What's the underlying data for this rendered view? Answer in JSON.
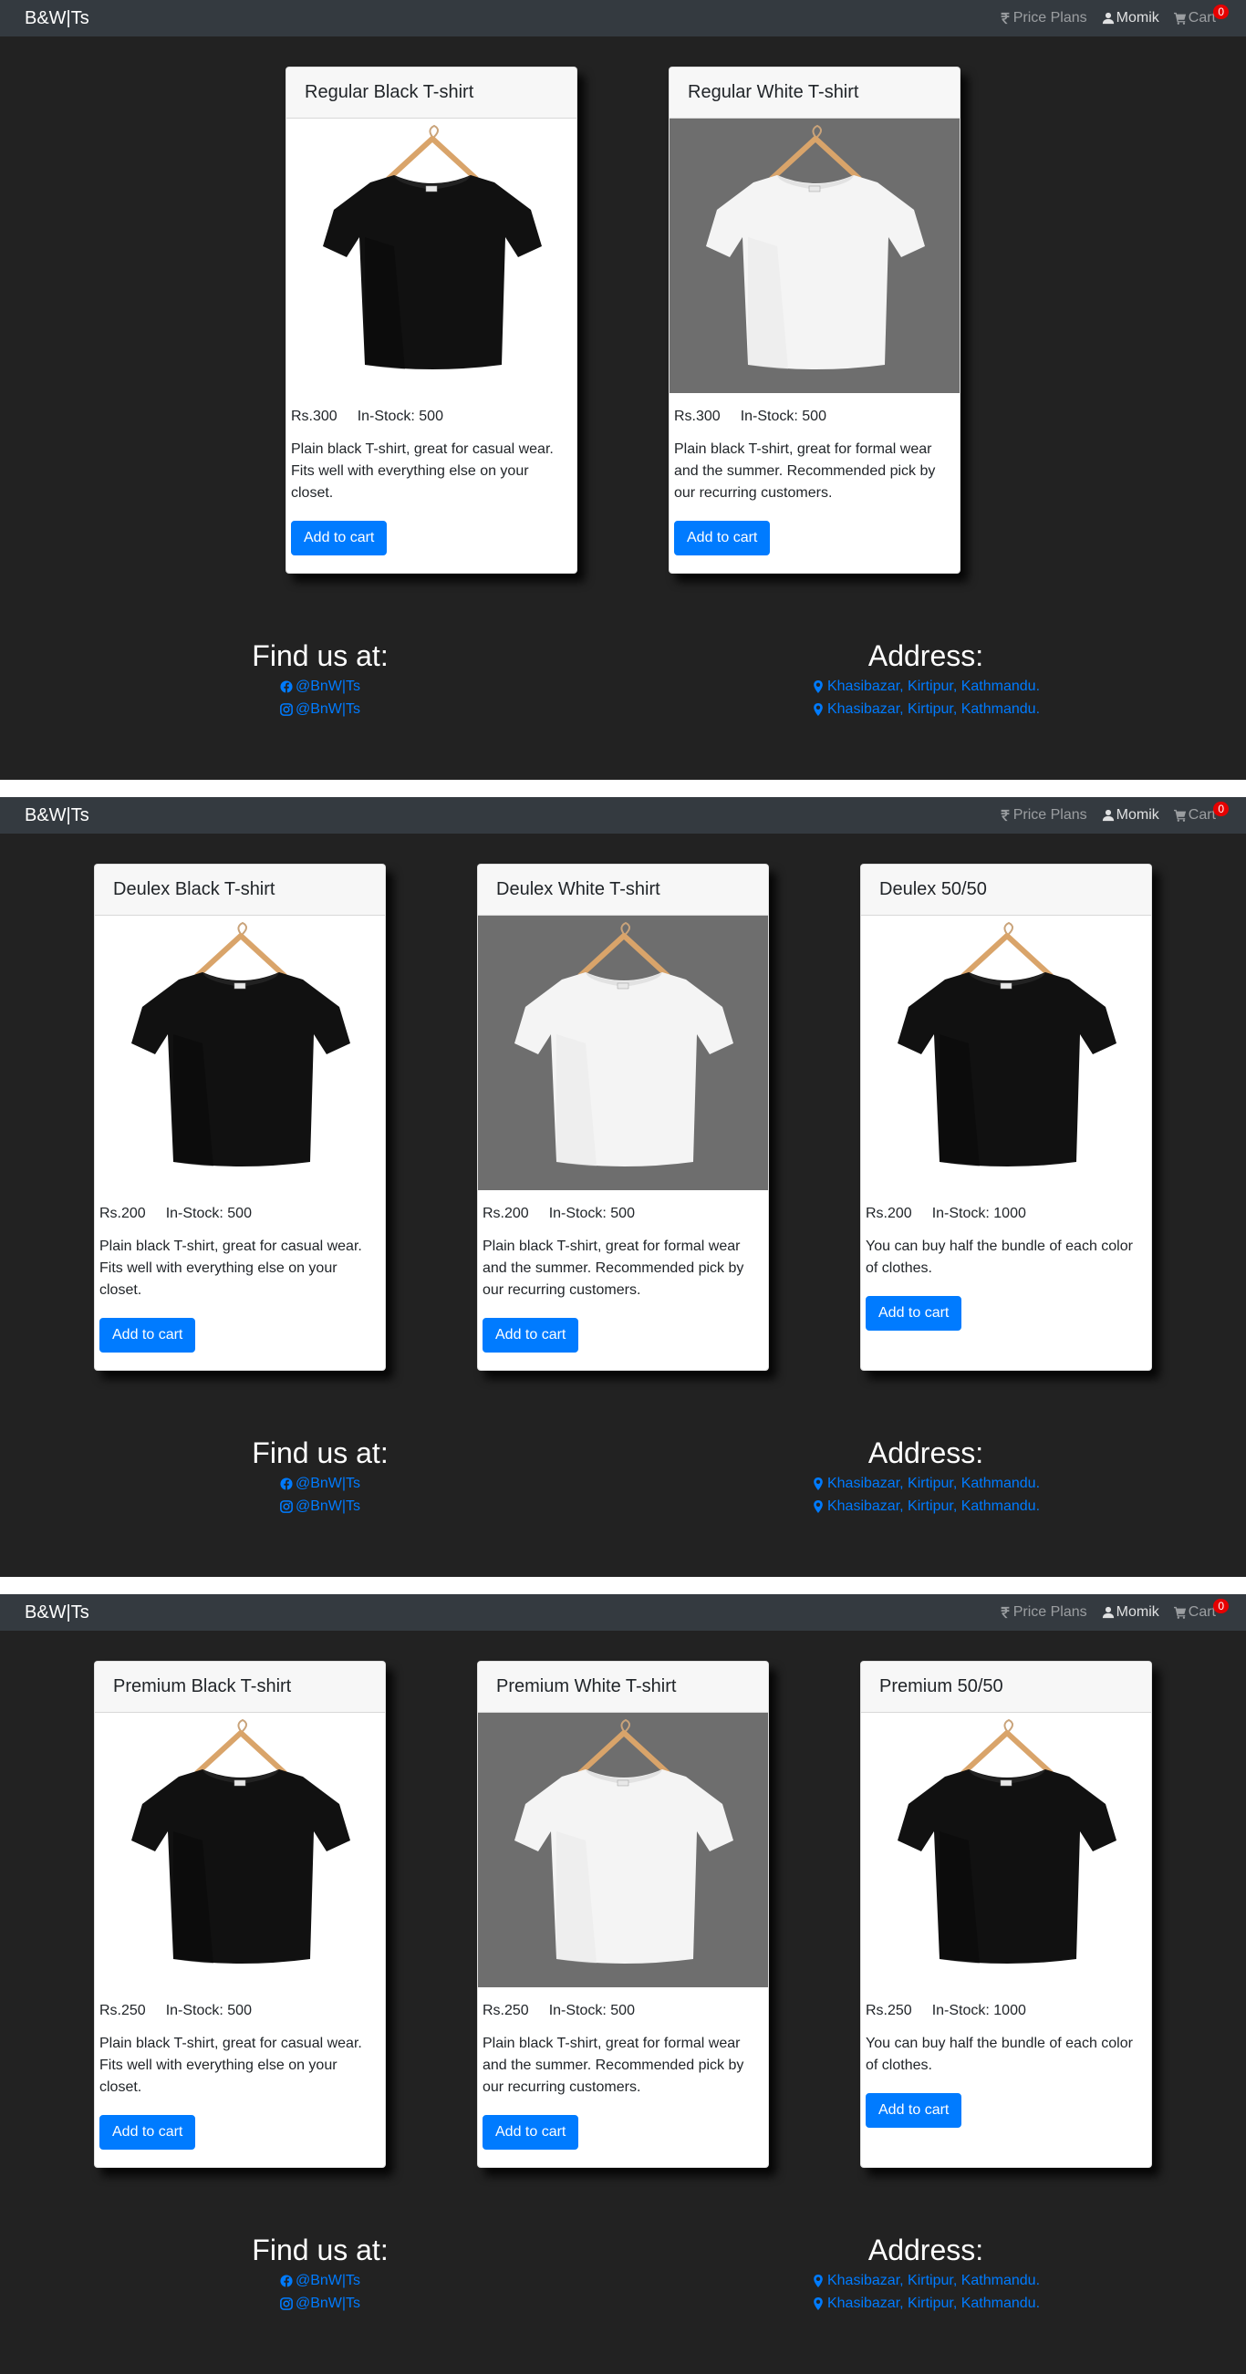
{
  "screens": [
    {
      "brand": "B&W|Ts",
      "nav": {
        "price_plans": "Price Plans",
        "user": "Momik",
        "cart": "Cart",
        "cart_count": "0"
      },
      "products": [
        {
          "name": "Regular Black T-shirt",
          "color": "black",
          "price": "Rs.300",
          "stock": "In-Stock: 500",
          "description": "Plain black T-shirt, great for casual wear. Fits well with everything else on your closet.",
          "button": "Add to cart"
        },
        {
          "name": "Regular White T-shirt",
          "color": "white",
          "price": "Rs.300",
          "stock": "In-Stock: 500",
          "description": "Plain black T-shirt, great for formal wear and the summer. Recommended pick by our recurring customers.",
          "button": "Add to cart"
        }
      ],
      "footer": {
        "find_title": "Find us at:",
        "facebook": "@BnW|Ts",
        "instagram": "@BnW|Ts",
        "address_title": "Address:",
        "address_1": "Khasibazar, Kirtipur, Kathmandu.",
        "address_2": "Khasibazar, Kirtipur, Kathmandu."
      }
    },
    {
      "brand": "B&W|Ts",
      "nav": {
        "price_plans": "Price Plans",
        "user": "Momik",
        "cart": "Cart",
        "cart_count": "0"
      },
      "products": [
        {
          "name": "Deulex Black T-shirt",
          "color": "black",
          "price": "Rs.200",
          "stock": "In-Stock: 500",
          "description": "Plain black T-shirt, great for casual wear. Fits well with everything else on your closet.",
          "button": "Add to cart"
        },
        {
          "name": "Deulex White T-shirt",
          "color": "white",
          "price": "Rs.200",
          "stock": "In-Stock: 500",
          "description": "Plain black T-shirt, great for formal wear and the summer. Recommended pick by our recurring customers.",
          "button": "Add to cart"
        },
        {
          "name": "Deulex 50/50",
          "color": "black",
          "price": "Rs.200",
          "stock": "In-Stock: 1000",
          "description": "You can buy half the bundle of each color of clothes.",
          "button": "Add to cart"
        }
      ],
      "footer": {
        "find_title": "Find us at:",
        "facebook": "@BnW|Ts",
        "instagram": "@BnW|Ts",
        "address_title": "Address:",
        "address_1": "Khasibazar, Kirtipur, Kathmandu.",
        "address_2": "Khasibazar, Kirtipur, Kathmandu."
      }
    },
    {
      "brand": "B&W|Ts",
      "nav": {
        "price_plans": "Price Plans",
        "user": "Momik",
        "cart": "Cart",
        "cart_count": "0"
      },
      "products": [
        {
          "name": "Premium Black T-shirt",
          "color": "black",
          "price": "Rs.250",
          "stock": "In-Stock: 500",
          "description": "Plain black T-shirt, great for casual wear. Fits well with everything else on your closet.",
          "button": "Add to cart"
        },
        {
          "name": "Premium White T-shirt",
          "color": "white",
          "price": "Rs.250",
          "stock": "In-Stock: 500",
          "description": "Plain black T-shirt, great for formal wear and the summer. Recommended pick by our recurring customers.",
          "button": "Add to cart"
        },
        {
          "name": "Premium 50/50",
          "color": "black",
          "price": "Rs.250",
          "stock": "In-Stock: 1000",
          "description": "You can buy half the bundle of each color of clothes.",
          "button": "Add to cart"
        }
      ],
      "footer": {
        "find_title": "Find us at:",
        "facebook": "@BnW|Ts",
        "instagram": "@BnW|Ts",
        "address_title": "Address:",
        "address_1": "Khasibazar, Kirtipur, Kathmandu.",
        "address_2": "Khasibazar, Kirtipur, Kathmandu."
      }
    }
  ]
}
